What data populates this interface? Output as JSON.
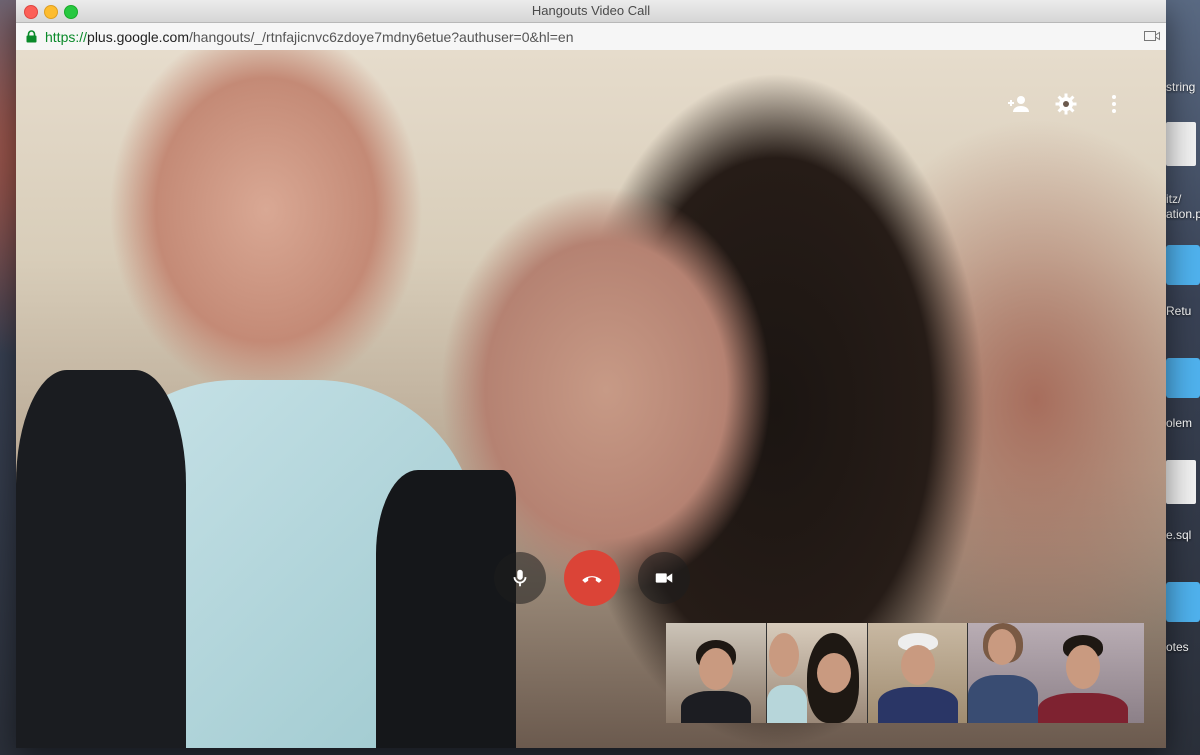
{
  "window": {
    "title": "Hangouts Video Call",
    "url_scheme": "https://",
    "url_host": "plus.google.com",
    "url_path": "/hangouts/_/rtnfajicnvc6zdoye7mdny6etue?authuser=0&hl=en"
  },
  "desktop": {
    "labels": [
      "string",
      "itz/",
      "ation.p",
      "Retu",
      "olem",
      "e.sql",
      "otes"
    ]
  },
  "call": {
    "top_controls": [
      "add-person-icon",
      "settings-gear-icon",
      "more-options-icon"
    ],
    "bottom_controls": [
      "microphone-icon",
      "hang-up-icon",
      "video-camera-icon"
    ],
    "colors": {
      "hangup": "#db4437",
      "lock_green": "#0a8a2a"
    },
    "participants_count": 5
  }
}
